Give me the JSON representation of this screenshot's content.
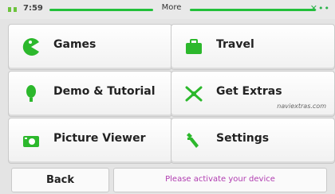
{
  "status": {
    "time": "7:59",
    "title": "More"
  },
  "menu": {
    "games": "Games",
    "travel": "Travel",
    "demo": "Demo & Tutorial",
    "extras": "Get Extras",
    "extras_sub": "naviextras.com",
    "picture_viewer": "Picture Viewer",
    "settings": "Settings"
  },
  "footer": {
    "back": "Back",
    "notice": "Please activate your device"
  },
  "colors": {
    "accent": "#22c03a",
    "notice": "#b03cb0"
  }
}
